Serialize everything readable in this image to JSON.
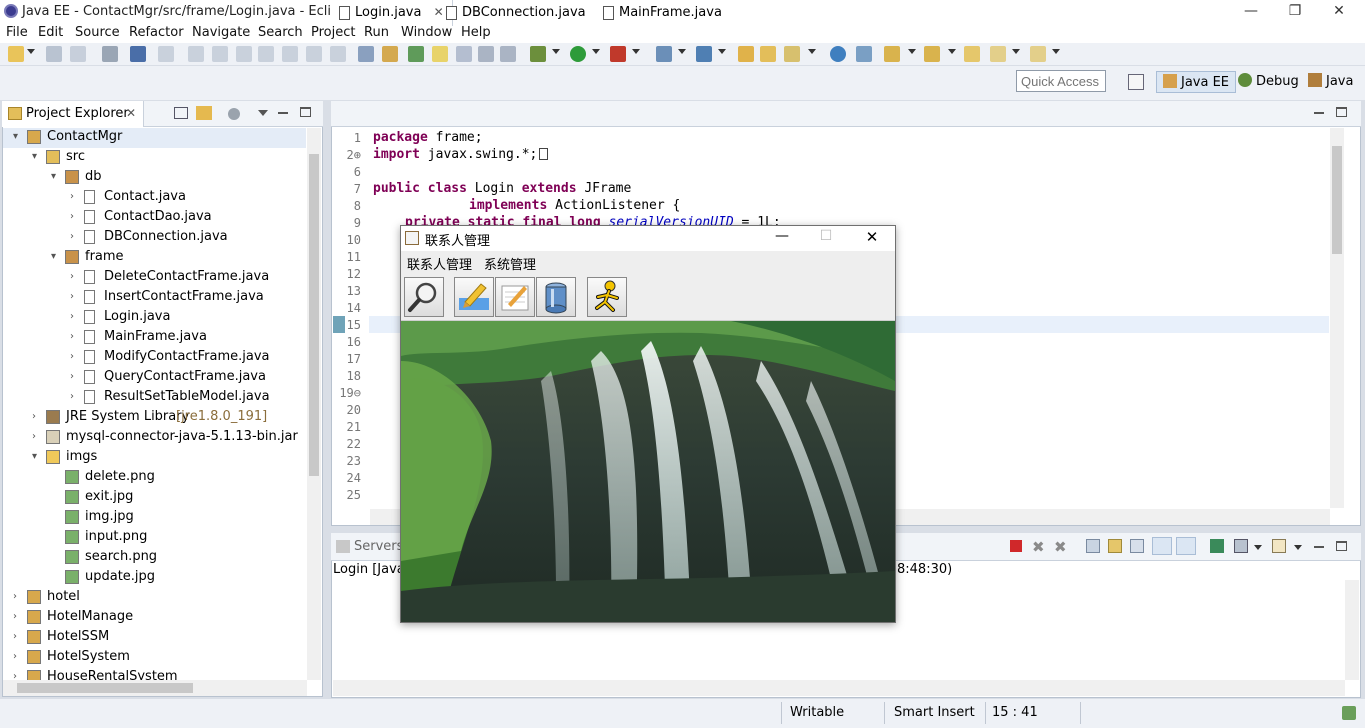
{
  "window": {
    "title": "Java EE - ContactMgr/src/frame/Login.java - Eclipse",
    "minimize": "—",
    "restore": "❐",
    "close": "✕"
  },
  "menu": [
    "File",
    "Edit",
    "Source",
    "Refactor",
    "Navigate",
    "Search",
    "Project",
    "Run",
    "Window",
    "Help"
  ],
  "quick_access": {
    "placeholder": "Quick Access"
  },
  "perspectives": [
    "Java EE",
    "Debug",
    "Java"
  ],
  "explorer": {
    "tab_label": "Project Explorer",
    "tab_close": "✕",
    "items": [
      {
        "label": "ContactMgr",
        "indent": 0,
        "arrow": "▾",
        "icon": "project-icon",
        "selected": true
      },
      {
        "label": "src",
        "indent": 1,
        "arrow": "▾",
        "icon": "source-folder-icon"
      },
      {
        "label": "db",
        "indent": 2,
        "arrow": "▾",
        "icon": "package-icon"
      },
      {
        "label": "Contact.java",
        "indent": 3,
        "arrow": "›",
        "icon": "java-file-icon"
      },
      {
        "label": "ContactDao.java",
        "indent": 3,
        "arrow": "›",
        "icon": "java-file-icon"
      },
      {
        "label": "DBConnection.java",
        "indent": 3,
        "arrow": "›",
        "icon": "java-file-icon"
      },
      {
        "label": "frame",
        "indent": 2,
        "arrow": "▾",
        "icon": "package-icon"
      },
      {
        "label": "DeleteContactFrame.java",
        "indent": 3,
        "arrow": "›",
        "icon": "java-file-icon"
      },
      {
        "label": "InsertContactFrame.java",
        "indent": 3,
        "arrow": "›",
        "icon": "java-file-icon"
      },
      {
        "label": "Login.java",
        "indent": 3,
        "arrow": "›",
        "icon": "java-file-icon"
      },
      {
        "label": "MainFrame.java",
        "indent": 3,
        "arrow": "›",
        "icon": "java-file-icon"
      },
      {
        "label": "ModifyContactFrame.java",
        "indent": 3,
        "arrow": "›",
        "icon": "java-file-icon"
      },
      {
        "label": "QueryContactFrame.java",
        "indent": 3,
        "arrow": "›",
        "icon": "java-file-icon"
      },
      {
        "label": "ResultSetTableModel.java",
        "indent": 3,
        "arrow": "›",
        "icon": "java-file-icon"
      },
      {
        "label": "JRE System Library",
        "suffix": "[jre1.8.0_191]",
        "indent": 1,
        "arrow": "›",
        "icon": "library-icon"
      },
      {
        "label": "mysql-connector-java-5.1.13-bin.jar",
        "indent": 1,
        "arrow": "›",
        "icon": "jar-icon"
      },
      {
        "label": "imgs",
        "indent": 1,
        "arrow": "▾",
        "icon": "folder-icon"
      },
      {
        "label": "delete.png",
        "indent": 2,
        "arrow": "",
        "icon": "image-file-icon"
      },
      {
        "label": "exit.jpg",
        "indent": 2,
        "arrow": "",
        "icon": "image-file-icon"
      },
      {
        "label": "img.jpg",
        "indent": 2,
        "arrow": "",
        "icon": "image-file-icon"
      },
      {
        "label": "input.png",
        "indent": 2,
        "arrow": "",
        "icon": "image-file-icon"
      },
      {
        "label": "search.png",
        "indent": 2,
        "arrow": "",
        "icon": "image-file-icon"
      },
      {
        "label": "update.jpg",
        "indent": 2,
        "arrow": "",
        "icon": "image-file-icon"
      },
      {
        "label": "hotel",
        "indent": 0,
        "arrow": "›",
        "icon": "project-icon"
      },
      {
        "label": "HotelManage",
        "indent": 0,
        "arrow": "›",
        "icon": "project-icon"
      },
      {
        "label": "HotelSSM",
        "indent": 0,
        "arrow": "›",
        "icon": "project-icon"
      },
      {
        "label": "HotelSystem",
        "indent": 0,
        "arrow": "›",
        "icon": "project-icon"
      },
      {
        "label": "HouseRentalSystem",
        "indent": 0,
        "arrow": "›",
        "icon": "project-icon"
      }
    ]
  },
  "editor": {
    "tabs": [
      "Login.java",
      "DBConnection.java",
      "MainFrame.java"
    ],
    "active_tab_close": "✕",
    "line_numbers": [
      "1",
      "2⊕",
      "6",
      "7",
      "8",
      "9",
      "10",
      "11",
      "12",
      "13",
      "14",
      "15",
      "16",
      "17",
      "18",
      "19⊖",
      "20",
      "21",
      "22",
      "23",
      "24",
      "25"
    ],
    "code": {
      "l1_kw": "package",
      "l1_rest": " frame;",
      "l2_kw": "import",
      "l2_rest": " javax.swing.*;",
      "l7_kw1": "public",
      "l7_kw2": " class",
      "l7_mid": " Login ",
      "l7_kw3": "extends",
      "l7_rest": " JFrame",
      "l8_kw": "implements",
      "l8_rest": " ActionListener {",
      "l9_kw": "private static final long",
      "l9_it": " serialVersionUID",
      "l9_rest": " = 1L;"
    }
  },
  "servers": {
    "tab_label": "Servers",
    "console_text_left": "Login [Java",
    "console_text_right": "8:48:30)"
  },
  "status": {
    "writable": "Writable",
    "insert_mode": "Smart Insert",
    "position": "15 : 41"
  },
  "dialog": {
    "title": "联系人管理",
    "minimize": "—",
    "maximize": "☐",
    "close": "✕",
    "menu": [
      "联系人管理",
      "系统管理"
    ],
    "tool_buttons": [
      "search-icon",
      "insert-icon",
      "update-icon",
      "delete-icon",
      "exit-icon"
    ]
  },
  "colors": {
    "keyword": "#7f0055",
    "field": "#0000c0",
    "selection": "#dde8f5",
    "panel": "#eef1f6"
  }
}
